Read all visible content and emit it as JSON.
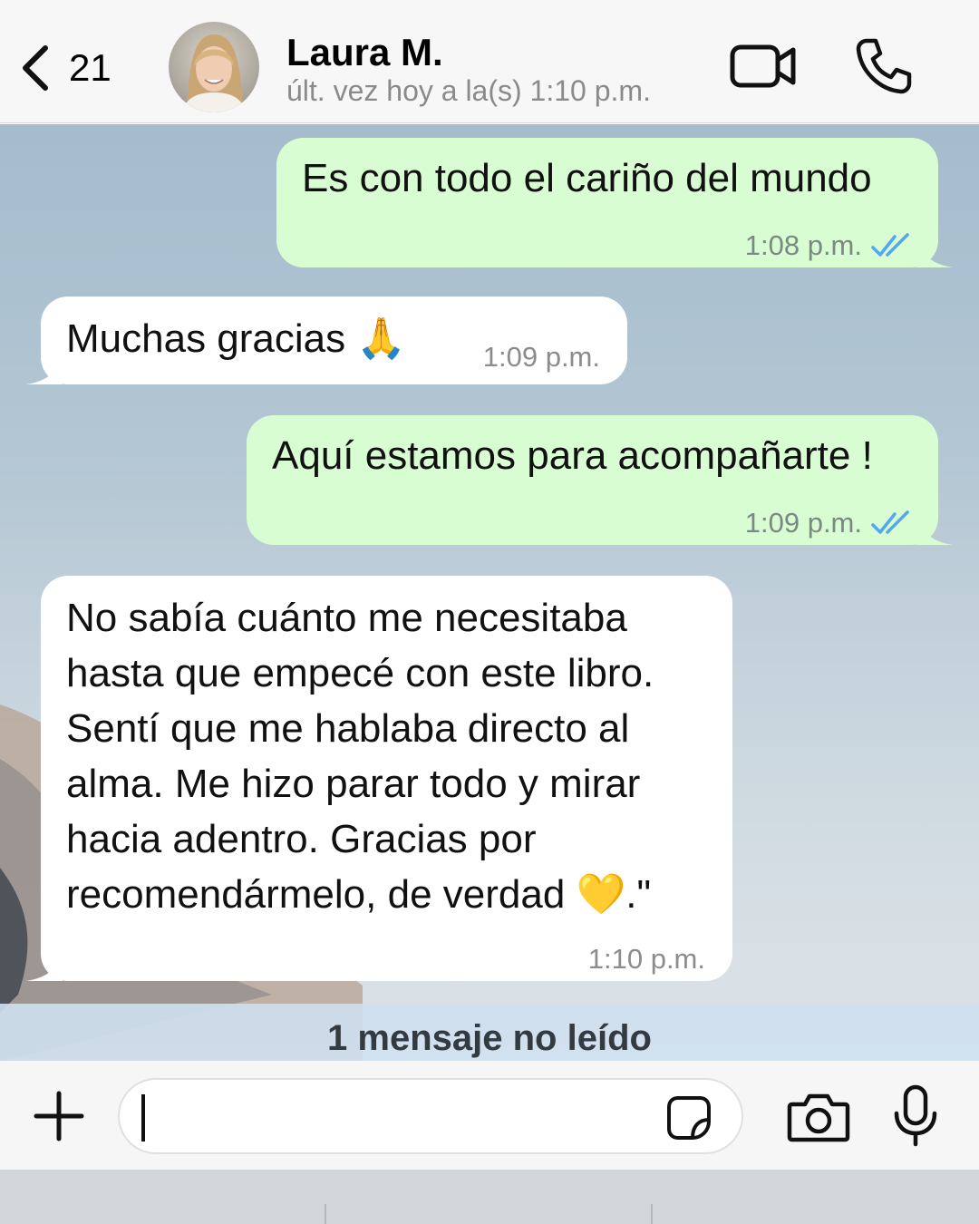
{
  "header": {
    "back_count": "21",
    "contact_name": "Laura M.",
    "last_seen": "últ. vez hoy a la(s) 1:10 p.m."
  },
  "messages": [
    {
      "direction": "outgoing",
      "text": "Es con todo el cariño del mundo",
      "time": "1:08 p.m.",
      "status": "read"
    },
    {
      "direction": "incoming",
      "text": "Muchas gracias 🙏",
      "time": "1:09 p.m."
    },
    {
      "direction": "outgoing",
      "text": "Aquí estamos para acompañarte !",
      "time": "1:09 p.m.",
      "status": "read"
    },
    {
      "direction": "incoming",
      "lines": [
        "No sabía cuánto me necesitaba",
        "hasta que empecé con este libro.",
        "Sentí que me hablaba directo al",
        "alma. Me hizo parar todo y mirar",
        "hacia adentro. Gracias por",
        "recomendármelo, de verdad 💛.\""
      ],
      "time": "1:10 p.m."
    }
  ],
  "unread_banner": "1 mensaje no leído",
  "input": {
    "value": "",
    "placeholder": ""
  },
  "icons": {
    "back": "chevron-left-icon",
    "video": "video-camera-icon",
    "call": "phone-icon",
    "attach": "plus-icon",
    "sticker": "sticker-icon",
    "camera": "camera-icon",
    "mic": "microphone-icon"
  },
  "colors": {
    "outgoing_bubble": "#d9fdd3",
    "incoming_bubble": "#ffffff",
    "read_ticks": "#53a6f0",
    "header_bg": "#f7f7f7"
  }
}
